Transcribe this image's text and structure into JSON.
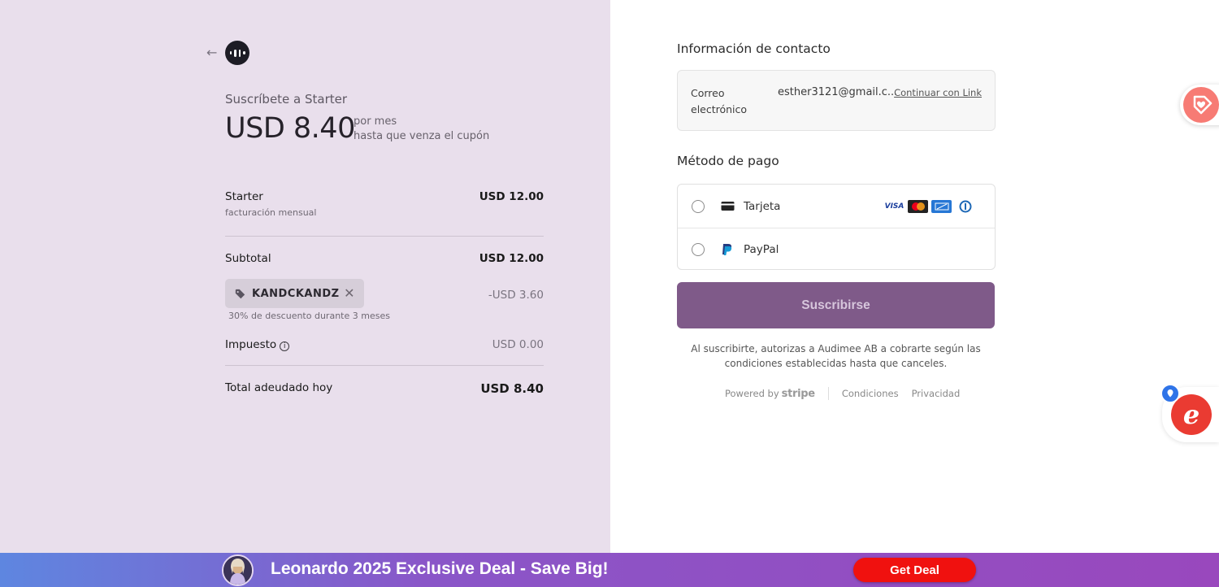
{
  "summary": {
    "subscribe_title": "Suscríbete a Starter",
    "price": "USD 8.40",
    "per_line1": "por mes",
    "per_line2": "hasta que venza el cupón",
    "plan_name": "Starter",
    "plan_price": "USD 12.00",
    "plan_billing": "facturación mensual",
    "subtotal_label": "Subtotal",
    "subtotal_value": "USD 12.00",
    "coupon_code": "KANDCKANDZ",
    "coupon_discount": "-USD 3.60",
    "coupon_description": "30% de descuento durante 3 meses",
    "tax_label": "Impuesto",
    "tax_value": "USD 0.00",
    "total_label": "Total adeudado hoy",
    "total_value": "USD 8.40"
  },
  "contact": {
    "heading": "Información de contacto",
    "email_label_line1": "Correo",
    "email_label_line2": "electrónico",
    "email_value": "esther3121@gmail.c...",
    "link_label": "Continuar con Link"
  },
  "payment": {
    "heading": "Método de pago",
    "methods": [
      {
        "label": "Tarjeta",
        "icon": "credit-card-icon"
      },
      {
        "label": "PayPal",
        "icon": "paypal-icon"
      }
    ],
    "card_brands": [
      "VISA"
    ],
    "subscribe_label": "Suscribirse",
    "terms": "Al suscribirte, autorizas a Audimee AB a cobrarte según las condiciones establecidas hasta que canceles."
  },
  "footer": {
    "powered_by": "Powered by",
    "stripe": "stripe",
    "terms_link": "Condiciones",
    "privacy_link": "Privacidad"
  },
  "banner": {
    "text": "Leonardo 2025 Exclusive Deal - Save Big!",
    "button": "Get Deal"
  },
  "colors": {
    "left_bg": "#e9dfec",
    "button": "#7f5a89",
    "banner_button": "#f0110f"
  }
}
